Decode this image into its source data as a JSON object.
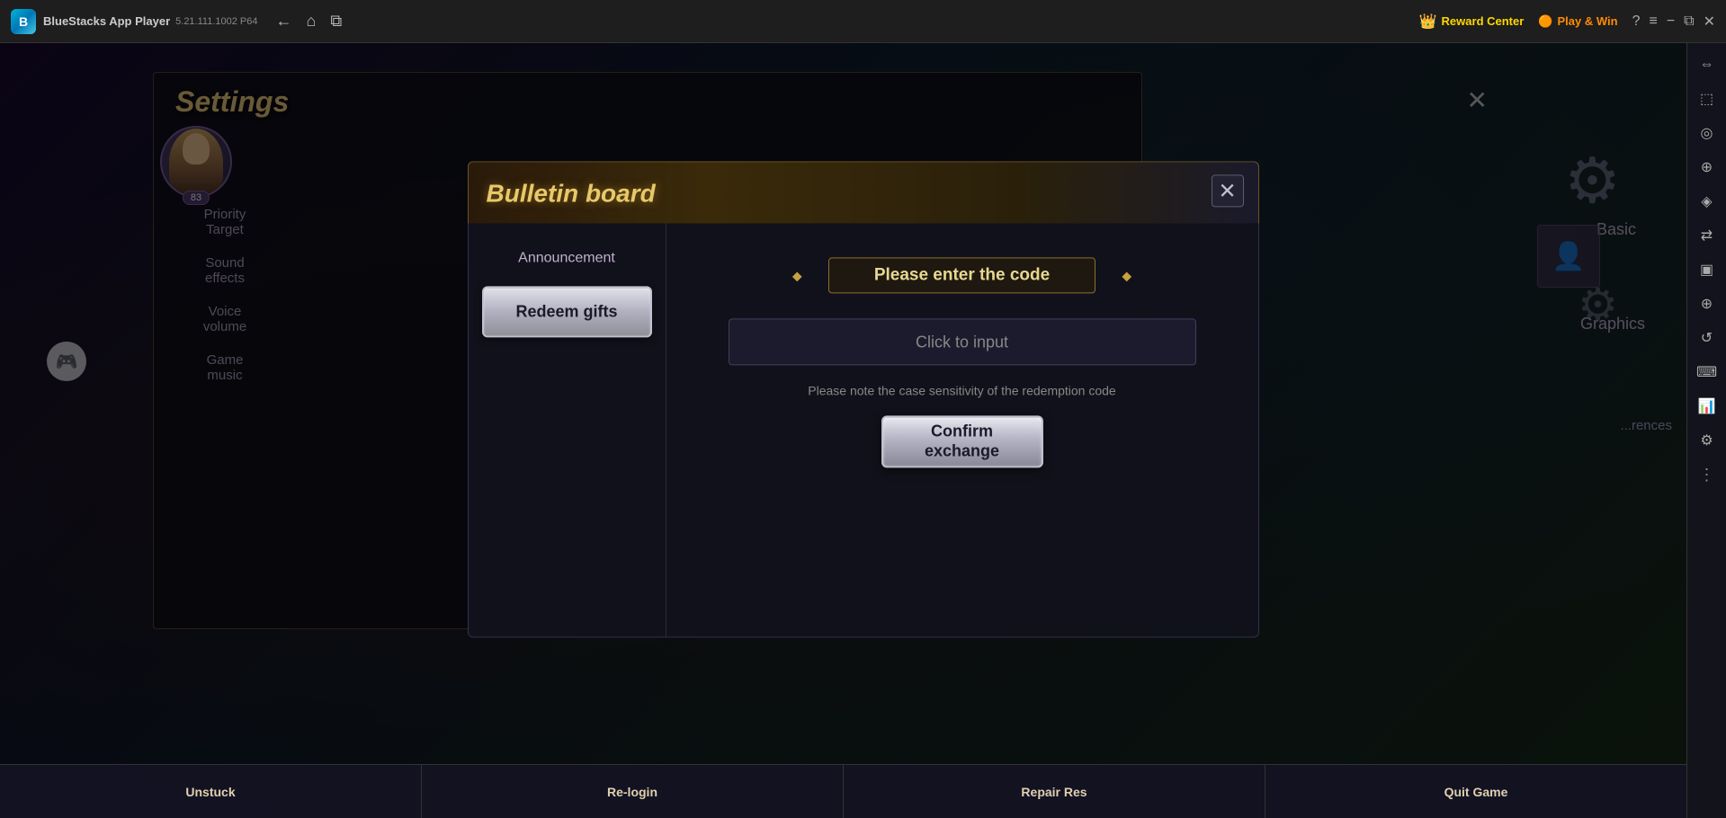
{
  "app": {
    "name": "BlueStacks App Player",
    "version": "5.21.111.1002  P64"
  },
  "topbar": {
    "back_label": "←",
    "home_label": "⌂",
    "tabs_label": "⧉",
    "reward_label": "Reward Center",
    "play_label": "Play & Win",
    "help_label": "?",
    "menu_label": "≡",
    "minimize_label": "−",
    "restore_label": "⧉",
    "close_label": "✕"
  },
  "game": {
    "settings_title": "Settings",
    "settings_close_label": "✕",
    "char_level": "83",
    "menu_items": [
      "Priority Target",
      "Sound effects",
      "Voice volume",
      "Game music"
    ],
    "right_labels": [
      "Basic",
      "Graphics",
      "...rences"
    ],
    "bottom_btns": [
      "Unstuck",
      "Re-login",
      "Repair Res",
      "Quit Game"
    ]
  },
  "bulletin": {
    "title": "Bulletin board",
    "close_label": "✕",
    "tabs": [
      {
        "id": "announcement",
        "label": "Announcement"
      },
      {
        "id": "redeem",
        "label": "Redeem gifts"
      }
    ],
    "active_tab": "redeem",
    "code_title": "Please enter the code",
    "input_placeholder": "Click to input",
    "case_note": "Please note the case sensitivity of the redemption code",
    "confirm_label_line1": "Confirm",
    "confirm_label_line2": "exchange"
  },
  "sidebar_icons": [
    "⬜",
    "⬛",
    "◎",
    "⬚",
    "◈",
    "⇄",
    "▣",
    "⊕",
    "⌀",
    "⋮"
  ]
}
